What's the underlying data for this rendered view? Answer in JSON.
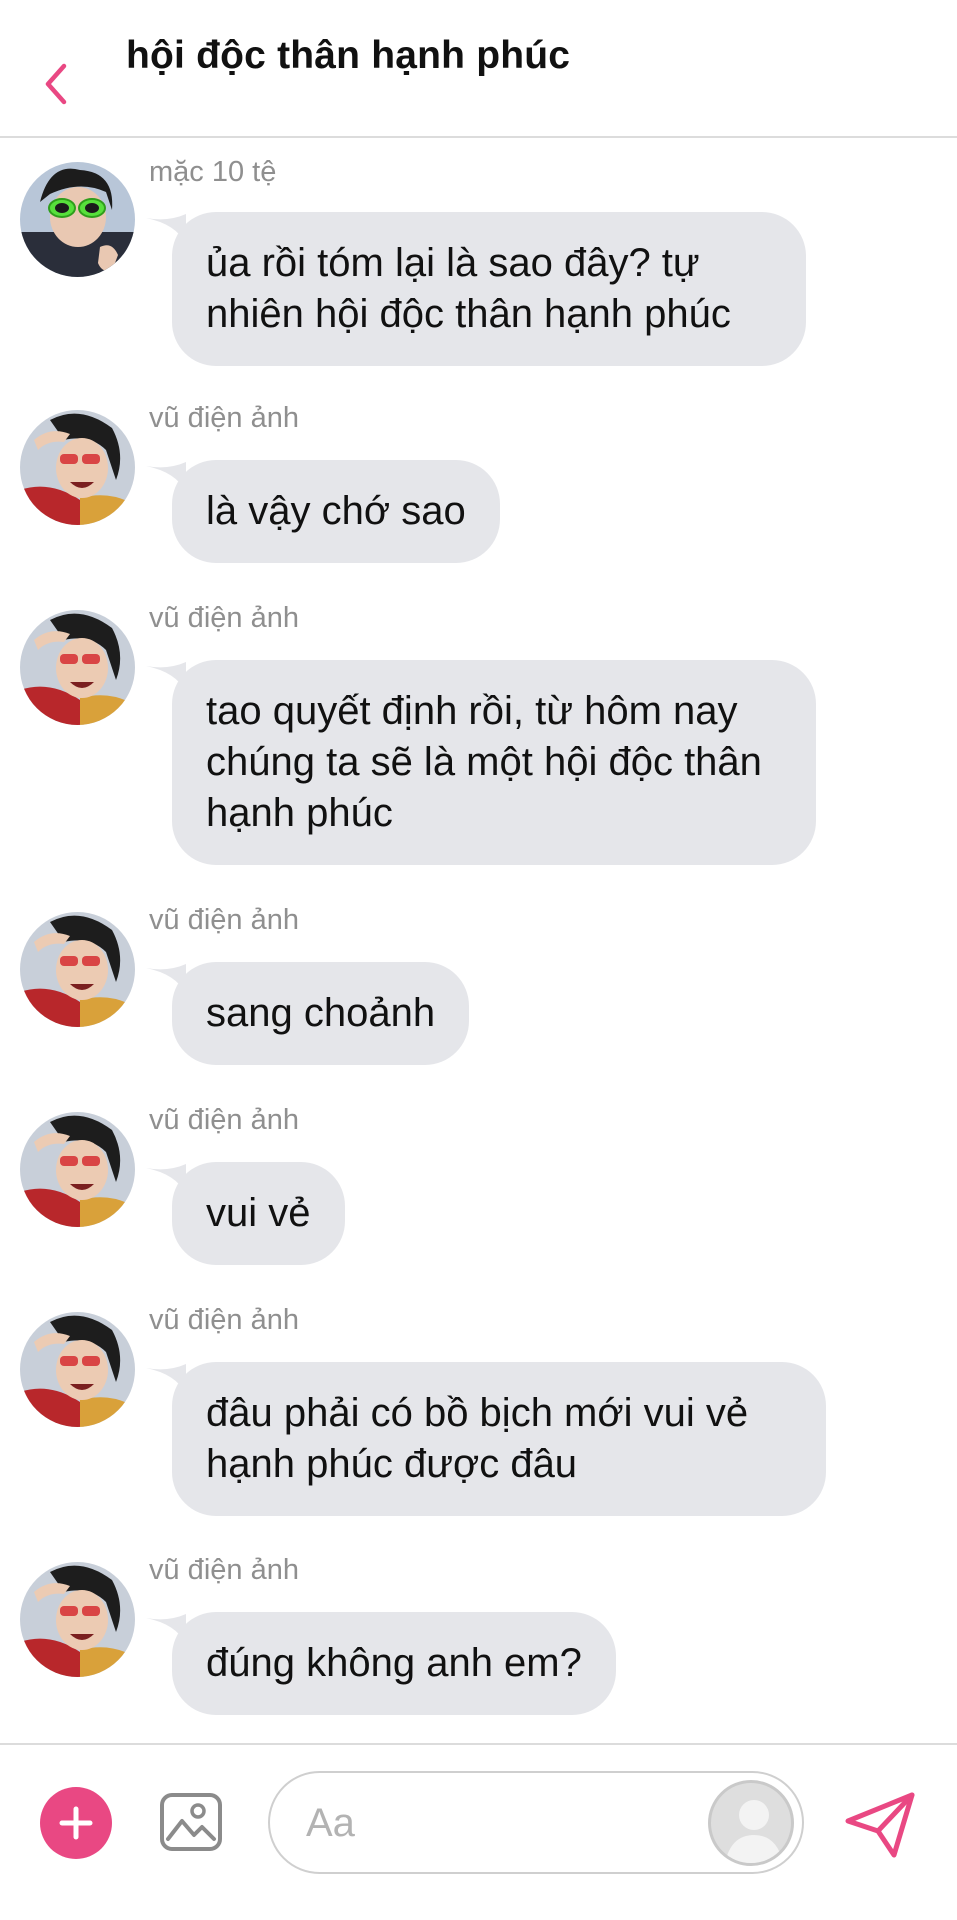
{
  "header": {
    "title": "hội độc thân hạnh phúc"
  },
  "messages": [
    {
      "sender": "mặc 10 tệ",
      "text": "ủa rồi tóm lại là sao đây? tự nhiên hội độc thân hạnh phúc",
      "avatar": "avatar-green-glasses"
    },
    {
      "sender": "vũ điện ảnh",
      "text": "là vậy chớ sao",
      "avatar": "avatar-red-glasses"
    },
    {
      "sender": "vũ điện ảnh",
      "text": "tao quyết định rồi, từ hôm nay chúng ta sẽ là một hội độc thân hạnh phúc",
      "avatar": "avatar-red-glasses"
    },
    {
      "sender": "vũ điện ảnh",
      "text": "sang choảnh",
      "avatar": "avatar-red-glasses"
    },
    {
      "sender": "vũ điện ảnh",
      "text": "vui vẻ",
      "avatar": "avatar-red-glasses"
    },
    {
      "sender": "vũ điện ảnh",
      "text": "đâu phải có bồ bịch mới vui vẻ hạnh phúc được đâu",
      "avatar": "avatar-red-glasses"
    },
    {
      "sender": "vũ điện ảnh",
      "text": "đúng không anh em?",
      "avatar": "avatar-red-glasses"
    }
  ],
  "composer": {
    "placeholder": "Aa"
  },
  "icons": {
    "back": "chevron-left-icon",
    "add": "plus-icon",
    "image": "image-icon",
    "send": "send-icon"
  },
  "colors": {
    "accent": "#e94883",
    "bubble": "#e5e6ea",
    "sender_text": "#8f8f8f",
    "placeholder": "#b3b3b3"
  }
}
